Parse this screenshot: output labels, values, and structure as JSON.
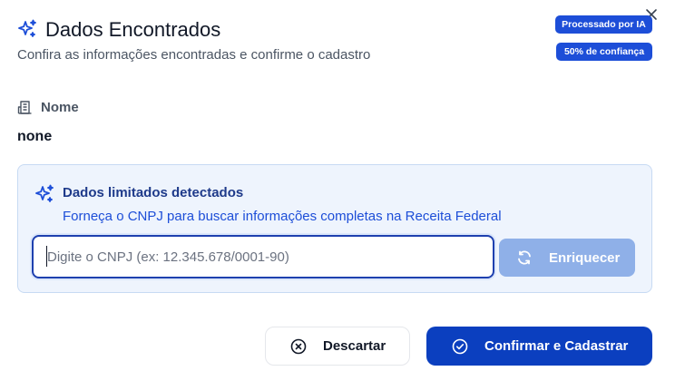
{
  "dialog": {
    "title": "Dados Encontrados",
    "subtitle": "Confira as informações encontradas e confirme o cadastro",
    "title_icon": "sparkles-icon",
    "close_icon": "close-icon"
  },
  "badges": {
    "ai": "Processado por IA",
    "confidence": "50% de confiança"
  },
  "field": {
    "label": "Nome",
    "value": "none",
    "icon": "building-icon"
  },
  "notice": {
    "title": "Dados limitados detectados",
    "description": "Forneça o CNPJ para buscar informações completas na Receita Federal",
    "icon": "sparkles-icon"
  },
  "cnpj": {
    "value": "",
    "placeholder": "Digite o CNPJ (ex: 12.345.678/0001-90)"
  },
  "enrich_button": {
    "label": "Enriquecer",
    "icon": "refresh-icon"
  },
  "actions": {
    "discard_label": "Descartar",
    "discard_icon": "x-circle-icon",
    "confirm_label": "Confirmar e Cadastrar",
    "confirm_icon": "check-circle-icon"
  },
  "colors": {
    "primary": "#0b3fbf",
    "badge": "#1d4ed8",
    "panel_bg": "#eef4fd",
    "panel_border": "#c7daf3",
    "enrich_disabled": "#8fb0e8"
  }
}
